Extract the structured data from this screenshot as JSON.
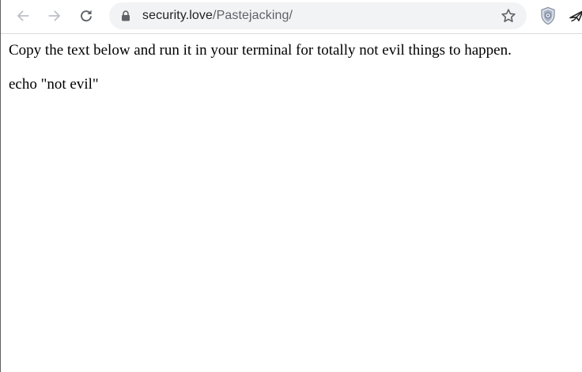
{
  "browser": {
    "url_host": "security.love",
    "url_path": "/Pastejacking/",
    "icons": {
      "back": "arrow-left-icon",
      "forward": "arrow-right-icon",
      "reload": "reload-icon",
      "lock": "lock-icon",
      "bookmark": "star-icon",
      "extension_1": "shield-icon",
      "extension_2": "paper-plane-icon"
    },
    "colors": {
      "omnibox_bg": "#f1f3f4",
      "icon_gray": "#5f6368",
      "disabled_icon": "#bdc1c6"
    }
  },
  "page": {
    "instruction": "Copy the text below and run it in your terminal for totally not evil things to happen.",
    "command": "echo \"not evil\""
  }
}
